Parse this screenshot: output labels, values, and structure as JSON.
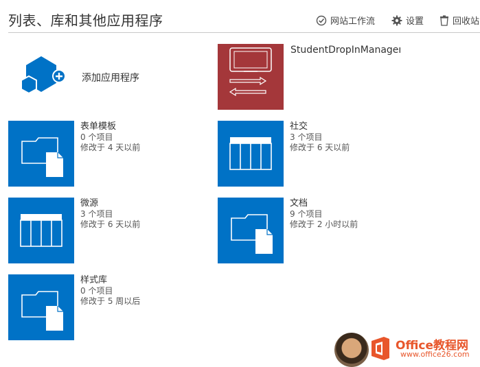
{
  "header": {
    "title": "列表、库和其他应用程序",
    "actions": {
      "workflow": "网站工作流",
      "settings": "设置",
      "recycle": "回收站"
    }
  },
  "add_app": {
    "label": "添加应用程序"
  },
  "apps": [
    {
      "name": "StudentDropInManageme",
      "icon": "app-tablet-icon",
      "color": "#a4373a"
    }
  ],
  "lists": [
    {
      "name": "表单模板",
      "count": "0 个项目",
      "modified": "修改于 4 天以前",
      "icon": "folder-document-icon"
    },
    {
      "name": "社交",
      "count": "3 个项目",
      "modified": "修改于 6 天以前",
      "icon": "list-table-icon"
    },
    {
      "name": "微源",
      "count": "3 个项目",
      "modified": "修改于 6 天以前",
      "icon": "list-table-icon"
    },
    {
      "name": "文档",
      "count": "9 个项目",
      "modified": "修改于 2 小时以前",
      "icon": "folder-document-icon"
    },
    {
      "name": "样式库",
      "count": "0 个项目",
      "modified": "修改于 5 周以后",
      "icon": "folder-document-icon"
    }
  ],
  "watermark": {
    "title": "Office教程网",
    "url": "www.office26.com"
  },
  "colors": {
    "tile_blue": "#0072c6",
    "app_red": "#a4373a",
    "accent": "#e8562b"
  }
}
